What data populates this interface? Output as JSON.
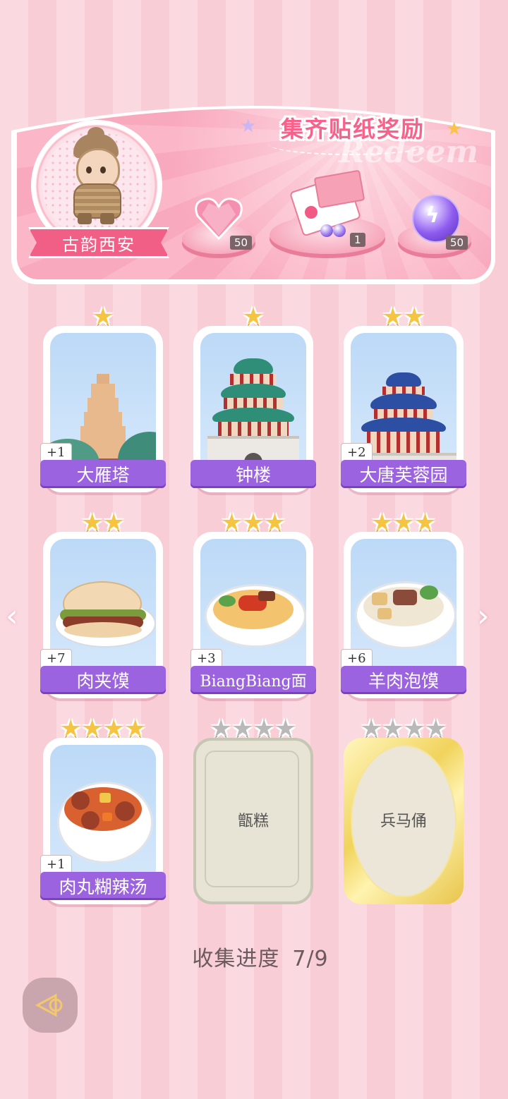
{
  "reward_panel": {
    "title": "集齐贴纸奖励",
    "watermark": "Redeem",
    "city_name": "古韵西安",
    "rewards": [
      {
        "icon": "pink-heart-gem-icon",
        "count": "50"
      },
      {
        "icon": "gift-box-icon",
        "count": "1"
      },
      {
        "icon": "lightning-orb-icon",
        "count": "50"
      }
    ]
  },
  "cards": [
    {
      "name": "大雁塔",
      "stars": 1,
      "max_stars": 1,
      "plus": "+1",
      "collected": true
    },
    {
      "name": "钟楼",
      "stars": 1,
      "max_stars": 1,
      "plus": "",
      "collected": true
    },
    {
      "name": "大唐芙蓉园",
      "stars": 2,
      "max_stars": 2,
      "plus": "+2",
      "collected": true
    },
    {
      "name": "肉夹馍",
      "stars": 2,
      "max_stars": 2,
      "plus": "+7",
      "collected": true
    },
    {
      "name": "BiangBiang面",
      "stars": 3,
      "max_stars": 3,
      "plus": "+3",
      "collected": true
    },
    {
      "name": "羊肉泡馍",
      "stars": 3,
      "max_stars": 3,
      "plus": "+6",
      "collected": true
    },
    {
      "name": "肉丸糊辣汤",
      "stars": 4,
      "max_stars": 4,
      "plus": "+1",
      "collected": true
    },
    {
      "name": "甑糕",
      "stars": 0,
      "max_stars": 4,
      "plus": "",
      "collected": false
    },
    {
      "name": "兵马俑",
      "stars": 0,
      "max_stars": 4,
      "plus": "",
      "collected": false
    }
  ],
  "progress": {
    "label": "收集进度",
    "value": "7/9"
  },
  "nav": {
    "prev": "‹",
    "next": "›"
  },
  "colors": {
    "accent": "#f7618a",
    "label_bg": "#9b63e0",
    "star": "#f5c542"
  }
}
